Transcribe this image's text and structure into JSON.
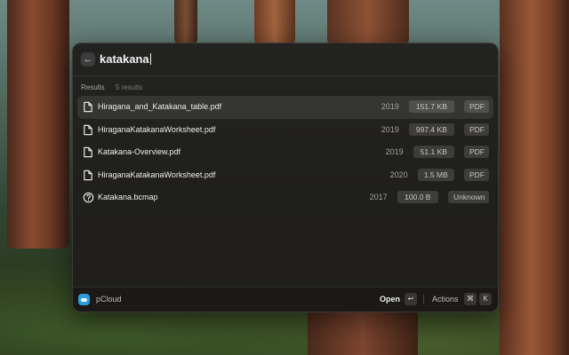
{
  "search": {
    "query": "katakana"
  },
  "section": {
    "title": "Results",
    "count": "5 results"
  },
  "results": [
    {
      "name": "Hiragana_and_Katakana_table.pdf",
      "year": "2019",
      "size": "151.7 KB",
      "type": "PDF",
      "icon": "file-icon",
      "selected": true
    },
    {
      "name": "HiraganaKatakanaWorksheet.pdf",
      "year": "2019",
      "size": "997.4 KB",
      "type": "PDF",
      "icon": "file-icon"
    },
    {
      "name": "Katakana-Overview.pdf",
      "year": "2019",
      "size": "51.1 KB",
      "type": "PDF",
      "icon": "file-icon"
    },
    {
      "name": "HiraganaKatakanaWorksheet.pdf",
      "year": "2020",
      "size": "1.5 MB",
      "type": "PDF",
      "icon": "file-icon"
    },
    {
      "name": "Katakana.bcmap",
      "year": "2017",
      "size": "100.0 B",
      "type": "Unknown",
      "icon": "question-circle-icon"
    }
  ],
  "footer": {
    "app_name": "pCloud",
    "primary_action": "Open",
    "primary_key": "↩",
    "actions_label": "Actions",
    "actions_keys": [
      "⌘",
      "K"
    ]
  },
  "colors": {
    "accent": "#2d9cdb"
  }
}
